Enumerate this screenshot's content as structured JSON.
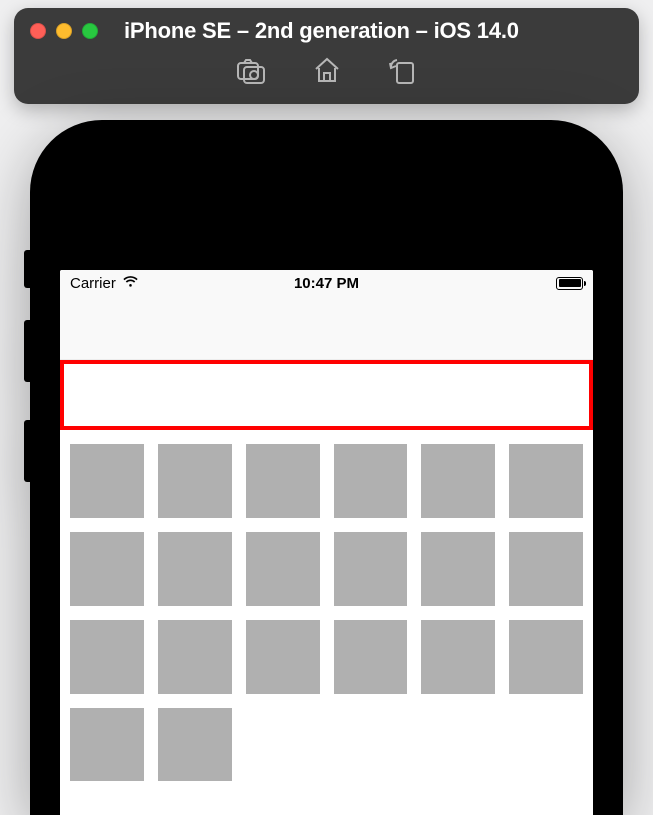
{
  "simulator": {
    "title": "iPhone SE – 2nd generation – iOS 14.0",
    "tools": {
      "screenshot": "screenshot",
      "home": "home",
      "rotate": "rotate"
    }
  },
  "status": {
    "carrier": "Carrier",
    "time": "10:47 PM"
  },
  "grid": {
    "columns": 6,
    "rows": 4,
    "visible_in_last_row": 2
  }
}
